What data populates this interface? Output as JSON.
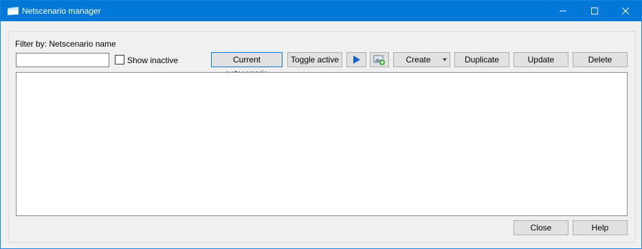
{
  "window": {
    "title": "Netscenario manager"
  },
  "filter": {
    "label": "Filter by: Netscenario name",
    "input_value": "",
    "show_inactive_label": "Show inactive",
    "show_inactive_checked": false
  },
  "toolbar": {
    "current_label": "Current netscenario",
    "toggle_active_label": "Toggle active",
    "run_icon": "play-icon",
    "import_icon": "image-add-icon",
    "create_label": "Create",
    "duplicate_label": "Duplicate",
    "update_label": "Update",
    "delete_label": "Delete"
  },
  "list": {
    "items": []
  },
  "footer": {
    "close_label": "Close",
    "help_label": "Help"
  },
  "colors": {
    "titlebar": "#0078d7",
    "accent_play": "#1565c0"
  }
}
